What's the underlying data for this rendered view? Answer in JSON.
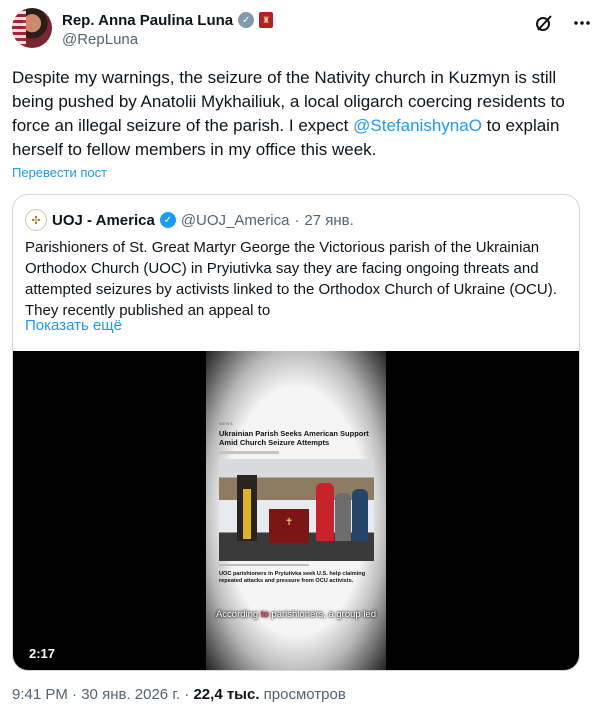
{
  "author": {
    "name": "Rep. Anna Paulina Luna",
    "handle": "@RepLuna"
  },
  "icons": {
    "verified": "verified-badge-icon",
    "house_seal": "house-seal-icon",
    "grok": "grok-icon",
    "more": "more-options-icon"
  },
  "tweet": {
    "text_before": "Despite my warnings, the seizure of the Nativity church in Kuzmyn is still being pushed by Anatolii Mykhailiuk, a local oligarch coercing residents to force an illegal seizure of the parish. I expect ",
    "mention": "@StefanishynaO",
    "text_after": " to explain herself to fellow members in my office this week.",
    "translate_label": "Перевести пост"
  },
  "quote": {
    "name": "UOJ - America",
    "handle": "@UOJ_America",
    "separator": "·",
    "date": "27 янв.",
    "text": "Parishioners of St. Great Martyr George the Victorious parish of the Ukrainian Orthodox Church (UOC) in Pryiutivka say they are facing ongoing threats and attempted seizures by activists linked to the Orthodox Church of Ukraine (OCU). They recently published an appeal to",
    "show_more": "Показать ещё",
    "video": {
      "duration": "2:17",
      "news_tag": "NEWS",
      "article_title": "Ukrainian Parish Seeks American Support Amid Church Seizure Attempts",
      "article_subtitle": "UOC parishioners in Pryiutivka seek U.S. help claiming repeated attacks and pressure from OCU activists.",
      "subtitle_before": "According ",
      "subtitle_highlight": "to",
      "subtitle_after": " parishioners, a group led"
    }
  },
  "footer": {
    "time": "9:41 PM",
    "separator": "·",
    "date": "30 янв. 2026 г.",
    "separator2": "·",
    "views_count": "22,4 тыс.",
    "views_label": "просмотров"
  },
  "colors": {
    "accent": "#1d9bf0",
    "text": "#0f1419",
    "muted": "#536471",
    "border": "#cfd9de"
  }
}
